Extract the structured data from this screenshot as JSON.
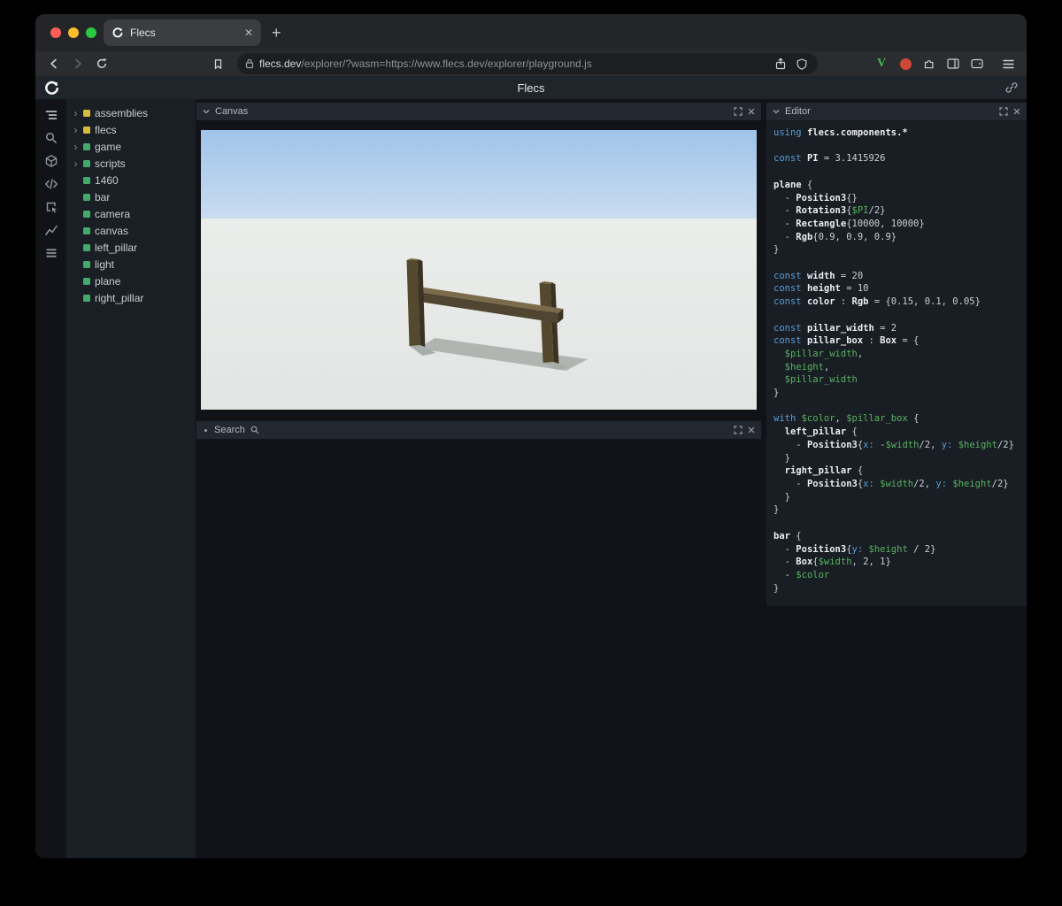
{
  "browser": {
    "tab": {
      "title": "Flecs"
    },
    "url": {
      "domain": "flecs.dev",
      "path": "/explorer/?wasm=https://www.flecs.dev/explorer/playground.js"
    }
  },
  "app": {
    "title": "Flecs"
  },
  "iconstrip": [
    "outliner-icon",
    "search-icon",
    "cube-icon",
    "code-icon",
    "inspect-icon",
    "stats-icon",
    "rows-icon"
  ],
  "tree": {
    "colors": {
      "module": "#d6bd3c",
      "entity": "#43aa6c"
    },
    "items": [
      {
        "label": "assemblies",
        "type": "module",
        "expandable": true
      },
      {
        "label": "flecs",
        "type": "module",
        "expandable": true
      },
      {
        "label": "game",
        "type": "entity",
        "expandable": true
      },
      {
        "label": "scripts",
        "type": "entity",
        "expandable": true
      },
      {
        "label": "1460",
        "type": "entity",
        "expandable": false
      },
      {
        "label": "bar",
        "type": "entity",
        "expandable": false
      },
      {
        "label": "camera",
        "type": "entity",
        "expandable": false
      },
      {
        "label": "canvas",
        "type": "entity",
        "expandable": false
      },
      {
        "label": "left_pillar",
        "type": "entity",
        "expandable": false
      },
      {
        "label": "light",
        "type": "entity",
        "expandable": false
      },
      {
        "label": "plane",
        "type": "entity",
        "expandable": false
      },
      {
        "label": "right_pillar",
        "type": "entity",
        "expandable": false
      }
    ]
  },
  "panels": {
    "canvas": {
      "title": "Canvas"
    },
    "search": {
      "title": "Search"
    },
    "editor": {
      "title": "Editor"
    }
  },
  "canvas_scene": {
    "colors": {
      "sky_top": "#9fc4e9",
      "sky_bottom": "#cadcf0",
      "ground_top": "#ebedeb",
      "ground_bottom": "#e2e5e3",
      "pillar_front": "#54492f",
      "pillar_side": "#3a3222",
      "bar_top": "#7b6b4a",
      "bar_front": "#4f4530",
      "shadow": "#b1b5b2",
      "shadow_dark": "#a9ada9"
    }
  },
  "editor": {
    "lines": [
      [
        [
          "k",
          "using "
        ],
        [
          "b",
          "flecs.components.*"
        ]
      ],
      [],
      [
        [
          "k",
          "const "
        ],
        [
          "b",
          "PI"
        ],
        [
          "d",
          " = 3.1415926"
        ]
      ],
      [],
      [
        [
          "b",
          "plane"
        ],
        [
          "d",
          " {"
        ]
      ],
      [
        [
          "d",
          "  - "
        ],
        [
          "b",
          "Position3"
        ],
        [
          "d",
          "{}"
        ]
      ],
      [
        [
          "d",
          "  - "
        ],
        [
          "b",
          "Rotation3"
        ],
        [
          "d",
          "{"
        ],
        [
          "v",
          "$PI"
        ],
        [
          "d",
          "/2}"
        ]
      ],
      [
        [
          "d",
          "  - "
        ],
        [
          "b",
          "Rectangle"
        ],
        [
          "d",
          "{10000, 10000}"
        ]
      ],
      [
        [
          "d",
          "  - "
        ],
        [
          "b",
          "Rgb"
        ],
        [
          "d",
          "{0.9, 0.9, 0.9}"
        ]
      ],
      [
        [
          "d",
          "}"
        ]
      ],
      [],
      [
        [
          "k",
          "const "
        ],
        [
          "b",
          "width"
        ],
        [
          "d",
          " = 20"
        ]
      ],
      [
        [
          "k",
          "const "
        ],
        [
          "b",
          "height"
        ],
        [
          "d",
          " = 10"
        ]
      ],
      [
        [
          "k",
          "const "
        ],
        [
          "b",
          "color"
        ],
        [
          "d",
          " : "
        ],
        [
          "b",
          "Rgb"
        ],
        [
          "d",
          " = {0.15, 0.1, 0.05}"
        ]
      ],
      [],
      [
        [
          "k",
          "const "
        ],
        [
          "b",
          "pillar_width"
        ],
        [
          "d",
          " = 2"
        ]
      ],
      [
        [
          "k",
          "const "
        ],
        [
          "b",
          "pillar_box"
        ],
        [
          "d",
          " : "
        ],
        [
          "b",
          "Box"
        ],
        [
          "d",
          " = {"
        ]
      ],
      [
        [
          "d",
          "  "
        ],
        [
          "v",
          "$pillar_width"
        ],
        [
          "d",
          ","
        ]
      ],
      [
        [
          "d",
          "  "
        ],
        [
          "v",
          "$height"
        ],
        [
          "d",
          ","
        ]
      ],
      [
        [
          "d",
          "  "
        ],
        [
          "v",
          "$pillar_width"
        ]
      ],
      [
        [
          "d",
          "}"
        ]
      ],
      [],
      [
        [
          "k",
          "with "
        ],
        [
          "v",
          "$color"
        ],
        [
          "d",
          ", "
        ],
        [
          "v",
          "$pillar_box"
        ],
        [
          "d",
          " {"
        ]
      ],
      [
        [
          "b",
          "  left_pillar"
        ],
        [
          "d",
          " {"
        ]
      ],
      [
        [
          "d",
          "    - "
        ],
        [
          "b",
          "Position3"
        ],
        [
          "d",
          "{"
        ],
        [
          "k",
          "x:"
        ],
        [
          "d",
          " -"
        ],
        [
          "v",
          "$width"
        ],
        [
          "d",
          "/2, "
        ],
        [
          "k",
          "y:"
        ],
        [
          "d",
          " "
        ],
        [
          "v",
          "$height"
        ],
        [
          "d",
          "/2}"
        ]
      ],
      [
        [
          "d",
          "  }"
        ]
      ],
      [
        [
          "b",
          "  right_pillar"
        ],
        [
          "d",
          " {"
        ]
      ],
      [
        [
          "d",
          "    - "
        ],
        [
          "b",
          "Position3"
        ],
        [
          "d",
          "{"
        ],
        [
          "k",
          "x:"
        ],
        [
          "d",
          " "
        ],
        [
          "v",
          "$width"
        ],
        [
          "d",
          "/2, "
        ],
        [
          "k",
          "y:"
        ],
        [
          "d",
          " "
        ],
        [
          "v",
          "$height"
        ],
        [
          "d",
          "/2}"
        ]
      ],
      [
        [
          "d",
          "  }"
        ]
      ],
      [
        [
          "d",
          "}"
        ]
      ],
      [],
      [
        [
          "b",
          "bar"
        ],
        [
          "d",
          " {"
        ]
      ],
      [
        [
          "d",
          "  - "
        ],
        [
          "b",
          "Position3"
        ],
        [
          "d",
          "{"
        ],
        [
          "k",
          "y:"
        ],
        [
          "d",
          " "
        ],
        [
          "v",
          "$height"
        ],
        [
          "d",
          " / 2}"
        ]
      ],
      [
        [
          "d",
          "  - "
        ],
        [
          "b",
          "Box"
        ],
        [
          "d",
          "{"
        ],
        [
          "v",
          "$width"
        ],
        [
          "d",
          ", 2, 1}"
        ]
      ],
      [
        [
          "d",
          "  - "
        ],
        [
          "v",
          "$color"
        ]
      ],
      [
        [
          "d",
          "}"
        ]
      ]
    ]
  }
}
